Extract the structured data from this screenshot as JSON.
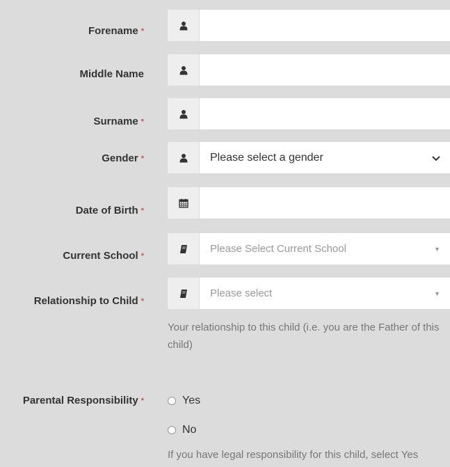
{
  "required_marker": "*",
  "fields": {
    "forename": {
      "label": "Forename",
      "value": ""
    },
    "middle_name": {
      "label": "Middle Name",
      "value": ""
    },
    "surname": {
      "label": "Surname",
      "value": ""
    },
    "gender": {
      "label": "Gender",
      "selected": "Please select a gender"
    },
    "dob": {
      "label": "Date of Birth",
      "value": ""
    },
    "current_school": {
      "label": "Current School",
      "placeholder": "Please Select Current School"
    },
    "relationship": {
      "label": "Relationship to Child",
      "placeholder": "Please select",
      "help": "Your relationship to this child (i.e. you are the Father of this child)"
    },
    "parental_responsibility": {
      "label": "Parental Responsibility",
      "options": [
        "Yes",
        "No"
      ],
      "help": "If you have legal responsibility for this child, select Yes"
    }
  },
  "icons": {
    "person": "user-icon",
    "calendar": "calendar-icon",
    "book": "book-icon",
    "chevron": "chevron-down-icon"
  },
  "colors": {
    "background": "#dcdcdc",
    "required": "#d9534f",
    "addon": "#eeeeee"
  }
}
